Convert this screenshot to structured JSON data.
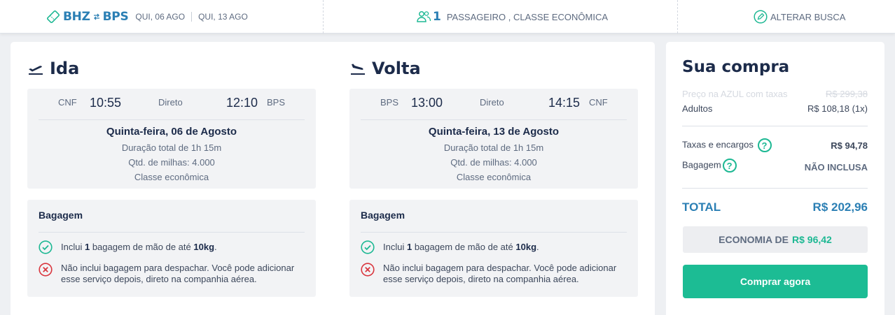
{
  "header": {
    "origin": "BHZ",
    "destination": "BPS",
    "date_out": "QUI, 06 AGO",
    "date_back": "QUI, 13 AGO",
    "passenger_count": "1",
    "passenger_text": "PASSAGEIRO , CLASSE ECONÔMICA",
    "edit_label": "ALTERAR BUSCA"
  },
  "legs": [
    {
      "title": "Ida",
      "from": "CNF",
      "departure": "10:55",
      "stops": "Direto",
      "arrival": "12:10",
      "to": "BPS",
      "date": "Quinta-feira, 06 de Agosto",
      "duration": "Duração total de 1h 15m",
      "miles": "Qtd. de milhas: 4.000",
      "cabin": "Classe econômica",
      "baggage": {
        "title": "Bagagem",
        "included_pre": "Inclui ",
        "included_qty": "1",
        "included_mid": " bagagem de mão de até ",
        "included_weight": "10kg",
        "included_end": ".",
        "excluded_line1": "Não inclui bagagem para despachar. Você pode adicionar",
        "excluded_line2": "esse serviço depois, direto na companhia aérea."
      }
    },
    {
      "title": "Volta",
      "from": "BPS",
      "departure": "13:00",
      "stops": "Direto",
      "arrival": "14:15",
      "to": "CNF",
      "date": "Quinta-feira, 13 de Agosto",
      "duration": "Duração total de 1h 15m",
      "miles": "Qtd. de milhas: 4.000",
      "cabin": "Classe econômica",
      "baggage": {
        "title": "Bagagem",
        "included_pre": "Inclui ",
        "included_qty": "1",
        "included_mid": " bagagem de mão de até ",
        "included_weight": "10kg",
        "included_end": ".",
        "excluded_line1": "Não inclui bagagem para despachar. Você pode adicionar",
        "excluded_line2": "esse serviço depois, direto na companhia aérea."
      }
    }
  ],
  "summary": {
    "title": "Sua compra",
    "airline_price_label": "Preço na AZUL com taxas",
    "airline_price": "R$ 299,38",
    "adults_label": "Adultos",
    "adults_price": "R$ 108,18 (1x)",
    "taxes_label": "Taxas e encargos",
    "taxes_value": "R$ 94,78",
    "baggage_label": "Bagagem",
    "baggage_value": "NÃO INCLUSA",
    "total_label": "TOTAL",
    "total_value": "R$ 202,96",
    "economy_label": "ECONOMIA DE",
    "economy_value": "R$ 96,42",
    "buy_label": "Comprar agora",
    "help_glyph": "?"
  },
  "colors": {
    "brand_blue": "#2b7fb4",
    "green": "#1db893",
    "error_red": "#d9363e",
    "navy": "#1c2b4a"
  },
  "icons": {
    "ticket": "ticket-icon",
    "swap": "swap-arrows-icon",
    "passenger": "passenger-icon",
    "edit": "pencil-icon",
    "takeoff": "airplane-takeoff-icon",
    "landing": "airplane-landing-icon",
    "check": "check-circle-icon",
    "cross": "x-circle-icon"
  }
}
